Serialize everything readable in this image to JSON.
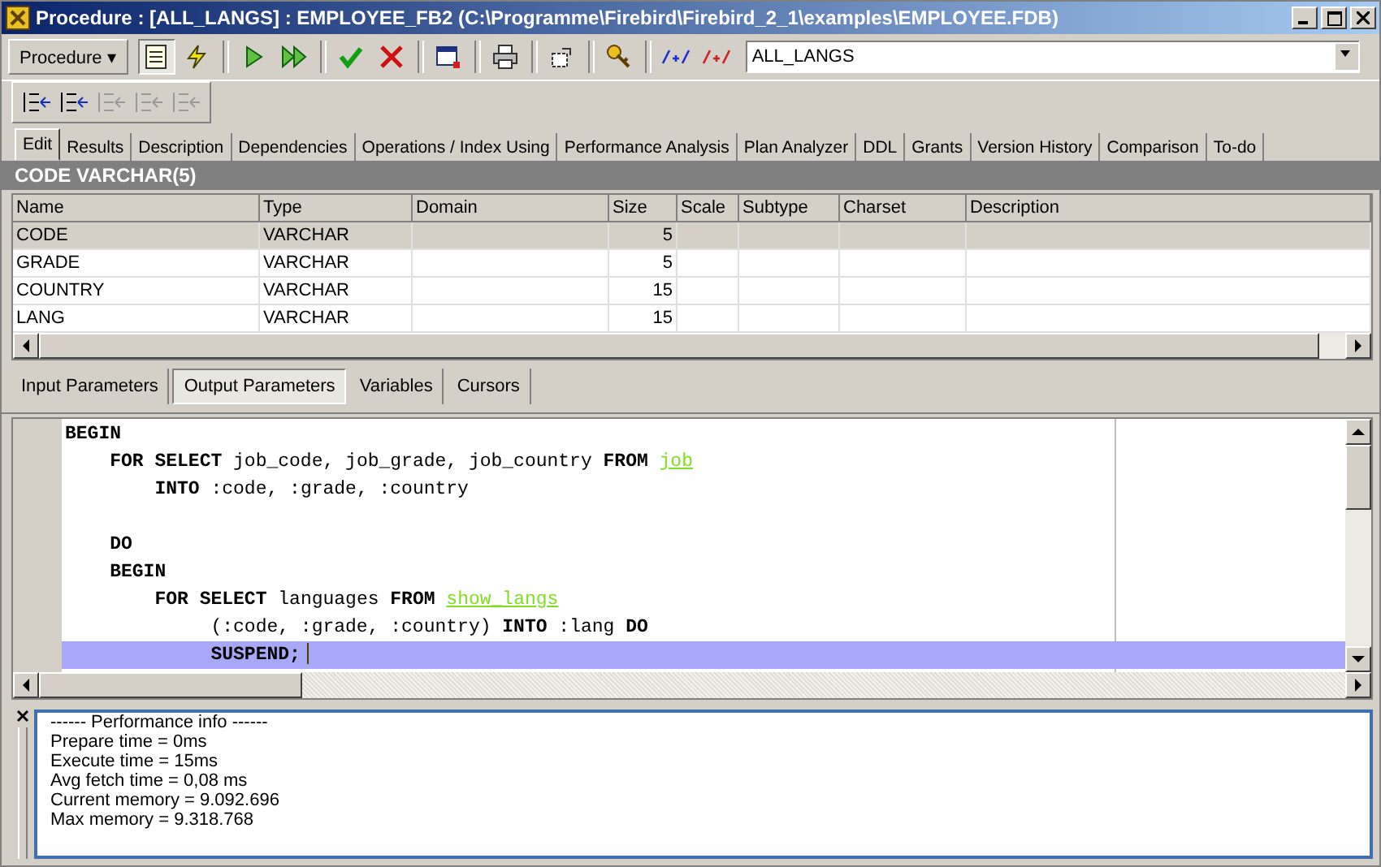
{
  "window": {
    "title": "Procedure : [ALL_LANGS] : EMPLOYEE_FB2 (C:\\Programme\\Firebird\\Firebird_2_1\\examples\\EMPLOYEE.FDB)"
  },
  "toolbar": {
    "menu_button": "Procedure ▾",
    "object_name": "ALL_LANGS"
  },
  "secondary_toolbar": [
    {
      "disabled": false
    },
    {
      "disabled": false
    },
    {
      "disabled": true
    },
    {
      "disabled": true
    },
    {
      "disabled": true
    }
  ],
  "tabs": [
    {
      "label": "Edit",
      "selected": true
    },
    {
      "label": "Results",
      "selected": false
    },
    {
      "label": "Description",
      "selected": false
    },
    {
      "label": "Dependencies",
      "selected": false
    },
    {
      "label": "Operations / Index Using",
      "selected": false
    },
    {
      "label": "Performance Analysis",
      "selected": false
    },
    {
      "label": "Plan Analyzer",
      "selected": false
    },
    {
      "label": "DDL",
      "selected": false
    },
    {
      "label": "Grants",
      "selected": false
    },
    {
      "label": "Version History",
      "selected": false
    },
    {
      "label": "Comparison",
      "selected": false
    },
    {
      "label": "To-do",
      "selected": false
    }
  ],
  "field_header": "CODE VARCHAR(5)",
  "table": {
    "columns": [
      "Name",
      "Type",
      "Domain",
      "Size",
      "Scale",
      "Subtype",
      "Charset",
      "Description"
    ],
    "rows": [
      {
        "cells": [
          "CODE",
          "VARCHAR",
          "",
          "5",
          "",
          "",
          "",
          ""
        ],
        "selected": true
      },
      {
        "cells": [
          "GRADE",
          "VARCHAR",
          "",
          "5",
          "",
          "",
          "",
          ""
        ],
        "selected": false
      },
      {
        "cells": [
          "COUNTRY",
          "VARCHAR",
          "",
          "15",
          "",
          "",
          "",
          ""
        ],
        "selected": false
      },
      {
        "cells": [
          "LANG",
          "VARCHAR",
          "",
          "15",
          "",
          "",
          "",
          ""
        ],
        "selected": false
      }
    ]
  },
  "sub_tabs": [
    {
      "label": "Input Parameters",
      "selected": false
    },
    {
      "label": "Output Parameters",
      "selected": true
    },
    {
      "label": "Variables",
      "selected": false
    },
    {
      "label": "Cursors",
      "selected": false
    }
  ],
  "code_lines": [
    {
      "highlighted": false,
      "segments": [
        {
          "kind": "kw",
          "text": "BEGIN"
        }
      ]
    },
    {
      "highlighted": false,
      "segments": [
        {
          "kind": "kw",
          "text": "    FOR SELECT"
        },
        {
          "kind": "plain",
          "text": " job_code, job_grade, job_country "
        },
        {
          "kind": "kw",
          "text": "FROM "
        },
        {
          "kind": "link",
          "text": "job"
        }
      ]
    },
    {
      "highlighted": false,
      "segments": [
        {
          "kind": "kw",
          "text": "        INTO"
        },
        {
          "kind": "plain",
          "text": " :code, :grade, :country"
        }
      ]
    },
    {
      "highlighted": false
    },
    {
      "highlighted": false,
      "segments": [
        {
          "kind": "kw",
          "text": "    DO"
        }
      ]
    },
    {
      "highlighted": false,
      "segments": [
        {
          "kind": "kw",
          "text": "    BEGIN"
        }
      ]
    },
    {
      "highlighted": false,
      "segments": [
        {
          "kind": "kw",
          "text": "        FOR SELECT"
        },
        {
          "kind": "plain",
          "text": " languages "
        },
        {
          "kind": "kw",
          "text": "FROM "
        },
        {
          "kind": "link",
          "text": "show_langs"
        }
      ]
    },
    {
      "highlighted": false,
      "segments": [
        {
          "kind": "plain",
          "text": "             (:code, :grade, :country) "
        },
        {
          "kind": "kw",
          "text": "INTO"
        },
        {
          "kind": "plain",
          "text": " :lang "
        },
        {
          "kind": "kw",
          "text": "DO"
        }
      ]
    },
    {
      "highlighted": true,
      "segments": [
        {
          "kind": "kw",
          "text": "             SUSPEND;"
        }
      ]
    }
  ],
  "performance_info": [
    "------ Performance info ------",
    "Prepare time = 0ms",
    "Execute time = 15ms",
    "Avg fetch time = 0,08 ms",
    "Current memory = 9.092.696",
    "Max memory = 9.318.768"
  ]
}
